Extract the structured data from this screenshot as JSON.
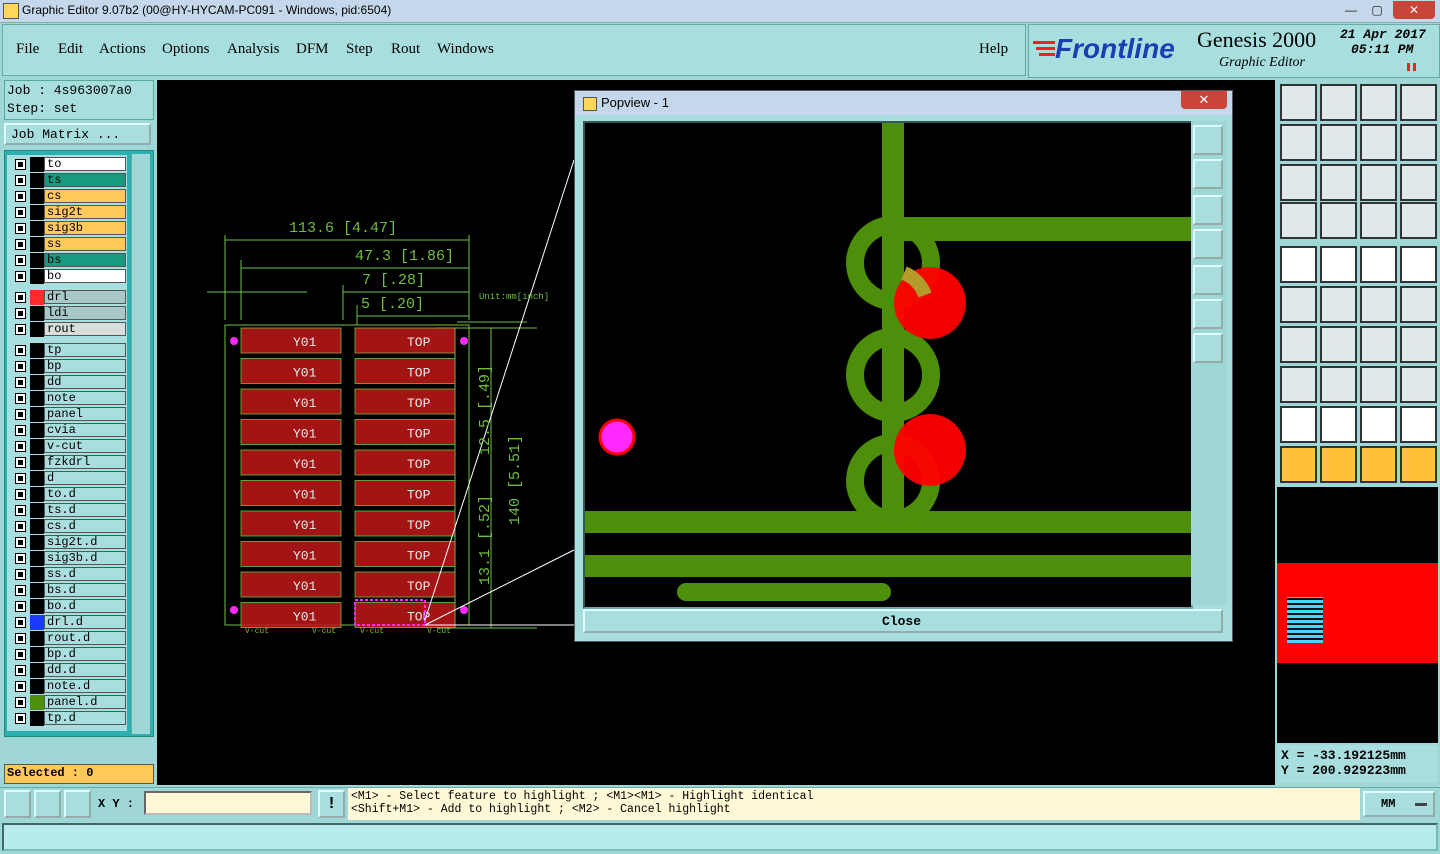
{
  "window": {
    "title": "Graphic Editor 9.07b2 (00@HY-HYCAM-PC091 - Windows, pid:6504)",
    "min": "—",
    "max": "▢",
    "close": "✕"
  },
  "menu": [
    "File",
    "Edit",
    "Actions",
    "Options",
    "Analysis",
    "DFM",
    "Step",
    "Rout",
    "Windows"
  ],
  "help": "Help",
  "branding": {
    "logo": "Frontline",
    "product": "Genesis 2000",
    "subtitle": "Graphic Editor",
    "date": "21 Apr 2017",
    "time": "05:11 PM"
  },
  "job": {
    "label": "Job : 4s963007a0",
    "step": "Step: set",
    "matrix_button": "Job Matrix ..."
  },
  "layers_group1": [
    {
      "name": "to",
      "color": "#ffffff"
    },
    {
      "name": "ts",
      "color": "#1a9a80"
    },
    {
      "name": "cs",
      "color": "#ffc85a"
    },
    {
      "name": "sig2t",
      "color": "#ffc85a"
    },
    {
      "name": "sig3b",
      "color": "#ffc85a"
    },
    {
      "name": "ss",
      "color": "#ffc85a"
    },
    {
      "name": "bs",
      "color": "#1a9a80"
    },
    {
      "name": "bo",
      "color": "#ffffff"
    }
  ],
  "layers_group2": [
    {
      "name": "drl",
      "color": "#a8c8c8"
    },
    {
      "name": "ldi",
      "color": "#a8c8c8"
    },
    {
      "name": "rout",
      "color": "#d8dede"
    }
  ],
  "layers_group3": [
    "tp",
    "bp",
    "dd",
    "note",
    "panel",
    "cvia",
    "v-cut",
    "fzkdrl",
    "d",
    "to.d",
    "ts.d",
    "cs.d",
    "sig2t.d",
    "sig3b.d",
    "ss.d",
    "bs.d",
    "bo.d",
    "drl.d",
    "rout.d",
    "bp.d",
    "dd.d",
    "note.d",
    "panel.d",
    "tp.d"
  ],
  "selected": "Selected : 0",
  "drawing": {
    "dims": [
      "113.6 [4.47]",
      "47.3 [1.86]",
      "7 [.28]",
      "5 [.20]"
    ],
    "unit_label": "Unit:mm[inch]",
    "vdim1": "12.5 [.49]",
    "vdim2": "140 [5.51]",
    "vdim3": "13.1 [.52]",
    "board_label_left": "Y01",
    "board_label_right": "TOP",
    "vcut": "V-cut"
  },
  "popview": {
    "title": "Popview - 1",
    "close_x": "✕",
    "close_button": "Close"
  },
  "coords": {
    "x": "X = -33.192125mm",
    "y": "Y = 200.929223mm"
  },
  "command": {
    "xy_label": "X Y :",
    "xy_value": "",
    "line1": "<M1> - Select feature to highlight ; <M1><M1> - Highlight identical",
    "line2": "<Shift+M1> - Add to highlight ; <M2> - Cancel highlight",
    "units": "MM"
  }
}
